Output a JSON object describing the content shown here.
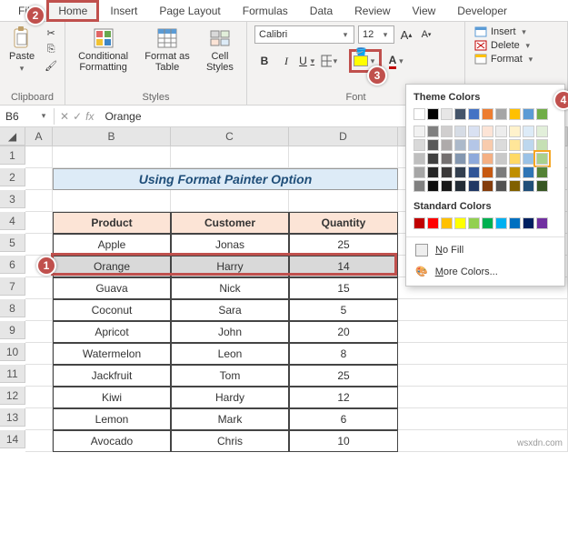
{
  "tabs": [
    "File",
    "Home",
    "Insert",
    "Page Layout",
    "Formulas",
    "Data",
    "Review",
    "View",
    "Developer"
  ],
  "active_tab": "Home",
  "clipboard": {
    "paste": "Paste",
    "label": "Clipboard"
  },
  "styles_group": {
    "conditional": "Conditional\nFormatting",
    "format_table": "Format as\nTable",
    "cell_styles": "Cell\nStyles",
    "label": "Styles"
  },
  "font_group": {
    "name": "Calibri",
    "size": "12",
    "bold": "B",
    "italic": "I",
    "underline": "U",
    "label": "Font"
  },
  "cells_group": {
    "insert": "Insert",
    "delete": "Delete",
    "format": "Format"
  },
  "name_box": "B6",
  "formula_value": "Orange",
  "columns": [
    "A",
    "B",
    "C",
    "D"
  ],
  "sheet_title": "Using Format Painter Option",
  "table": {
    "headers": [
      "Product",
      "Customer",
      "Quantity"
    ],
    "rows": [
      [
        "Apple",
        "Jonas",
        "25"
      ],
      [
        "Orange",
        "Harry",
        "14"
      ],
      [
        "Guava",
        "Nick",
        "15"
      ],
      [
        "Coconut",
        "Sara",
        "5"
      ],
      [
        "Apricot",
        "John",
        "20"
      ],
      [
        "Watermelon",
        "Leon",
        "8"
      ],
      [
        "Jackfruit",
        "Tom",
        "25"
      ],
      [
        "Kiwi",
        "Hardy",
        "12"
      ],
      [
        "Lemon",
        "Mark",
        "6"
      ],
      [
        "Avocado",
        "Chris",
        "10"
      ]
    ],
    "selected_row_index": 1
  },
  "color_picker": {
    "theme_label": "Theme Colors",
    "theme_colors_row": [
      "#ffffff",
      "#000000",
      "#e7e6e6",
      "#44546a",
      "#4472c4",
      "#ed7d31",
      "#a5a5a5",
      "#ffc000",
      "#5b9bd5",
      "#70ad47"
    ],
    "theme_tints": [
      [
        "#f2f2f2",
        "#808080",
        "#d0cece",
        "#d6dce5",
        "#d9e1f2",
        "#fce4d6",
        "#ededed",
        "#fff2cc",
        "#ddebf7",
        "#e2efda"
      ],
      [
        "#d9d9d9",
        "#595959",
        "#aeaaaa",
        "#acb9ca",
        "#b4c6e7",
        "#f8cbad",
        "#dbdbdb",
        "#ffe699",
        "#bdd7ee",
        "#c6e0b4"
      ],
      [
        "#bfbfbf",
        "#404040",
        "#757171",
        "#8497b0",
        "#8ea9db",
        "#f4b084",
        "#c9c9c9",
        "#ffd966",
        "#9bc2e6",
        "#a9d08e"
      ],
      [
        "#a6a6a6",
        "#262626",
        "#3a3838",
        "#333f4f",
        "#305496",
        "#c65911",
        "#7b7b7b",
        "#bf8f00",
        "#2f75b5",
        "#548235"
      ],
      [
        "#808080",
        "#0d0d0d",
        "#161616",
        "#222b35",
        "#203764",
        "#833c0c",
        "#525252",
        "#806000",
        "#1f4e78",
        "#375623"
      ]
    ],
    "standard_label": "Standard Colors",
    "standard_colors": [
      "#c00000",
      "#ff0000",
      "#ffc000",
      "#ffff00",
      "#92d050",
      "#00b050",
      "#00b0f0",
      "#0070c0",
      "#002060",
      "#7030a0"
    ],
    "no_fill": "No Fill",
    "more_colors": "More Colors...",
    "selected_theme": {
      "row": 2,
      "col": 9
    }
  },
  "callouts": {
    "c1": "1",
    "c2": "2",
    "c3": "3",
    "c4": "4"
  },
  "watermark": "wsxdn.com"
}
